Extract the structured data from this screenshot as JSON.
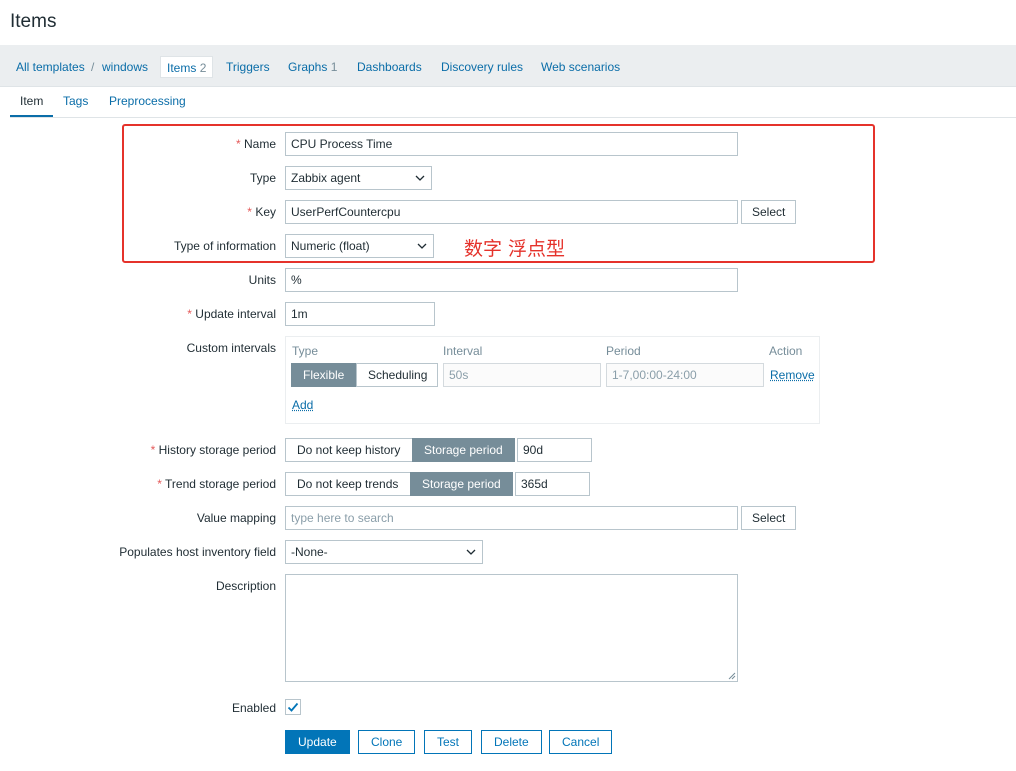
{
  "page": {
    "title": "Items"
  },
  "breadcrumbs": {
    "all_templates": "All templates",
    "separator": "/",
    "template": "windows",
    "items_label": "Items",
    "items_count": "2",
    "triggers": "Triggers",
    "graphs_label": "Graphs",
    "graphs_count": "1",
    "dashboards": "Dashboards",
    "discovery_rules": "Discovery rules",
    "web_scenarios": "Web scenarios"
  },
  "tabs": {
    "item": "Item",
    "tags": "Tags",
    "preprocessing": "Preprocessing"
  },
  "form": {
    "required_mark": "*",
    "name": {
      "label": "Name",
      "value": "CPU Process Time"
    },
    "type": {
      "label": "Type",
      "value": "Zabbix agent"
    },
    "key": {
      "label": "Key",
      "value": "UserPerfCountercpu",
      "select": "Select"
    },
    "type_of_information": {
      "label": "Type of information",
      "value": "Numeric (float)"
    },
    "units": {
      "label": "Units",
      "value": "%"
    },
    "update_interval": {
      "label": "Update interval",
      "value": "1m"
    },
    "custom_intervals": {
      "label": "Custom intervals",
      "headers": {
        "type": "Type",
        "interval": "Interval",
        "period": "Period",
        "action": "Action"
      },
      "flexible": "Flexible",
      "scheduling": "Scheduling",
      "interval_placeholder": "50s",
      "period_placeholder": "1-7,00:00-24:00",
      "remove": "Remove",
      "add": "Add"
    },
    "history": {
      "label": "History storage period",
      "do_not_keep": "Do not keep history",
      "storage_period": "Storage period",
      "value": "90d"
    },
    "trends": {
      "label": "Trend storage period",
      "do_not_keep": "Do not keep trends",
      "storage_period": "Storage period",
      "value": "365d"
    },
    "value_mapping": {
      "label": "Value mapping",
      "placeholder": "type here to search",
      "select": "Select"
    },
    "inventory": {
      "label": "Populates host inventory field",
      "value": "-None-"
    },
    "description": {
      "label": "Description"
    },
    "enabled": {
      "label": "Enabled",
      "checked": true
    }
  },
  "buttons": {
    "update": "Update",
    "clone": "Clone",
    "test": "Test",
    "delete": "Delete",
    "cancel": "Cancel"
  },
  "annotation": {
    "text": "数字 浮点型",
    "color": "#e5322b"
  },
  "colors": {
    "link": "#0a6da8",
    "primary": "#0275b8",
    "required": "#e45959",
    "segment_active": "#768d99"
  }
}
